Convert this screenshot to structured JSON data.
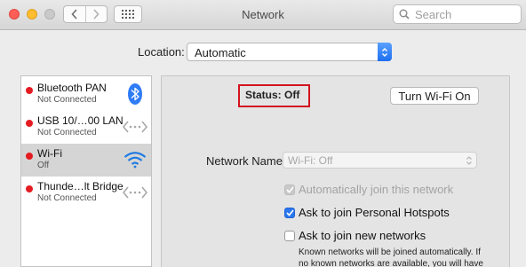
{
  "window": {
    "title": "Network"
  },
  "toolbar": {
    "back_icon": "chevron-left-icon",
    "forward_icon": "chevron-right-icon",
    "grid_icon": "grid-icon",
    "search_placeholder": "Search"
  },
  "location": {
    "label": "Location:",
    "value": "Automatic"
  },
  "sidebar": {
    "items": [
      {
        "name": "Bluetooth PAN",
        "status": "Not Connected",
        "icon": "bluetooth-icon",
        "status_color": "#e41c22"
      },
      {
        "name": "USB 10/…00 LAN",
        "status": "Not Connected",
        "icon": "ethernet-arrows-icon",
        "status_color": "#e41c22"
      },
      {
        "name": "Wi-Fi",
        "status": "Off",
        "icon": "wifi-icon",
        "status_color": "#e41c22",
        "selected": true
      },
      {
        "name": "Thunde…lt Bridge",
        "status": "Not Connected",
        "icon": "ethernet-arrows-icon",
        "status_color": "#e41c22"
      }
    ]
  },
  "main": {
    "status_label": "Status:",
    "status_value": "Off",
    "turn_wifi_button": "Turn Wi-Fi On",
    "network_name_label": "Network Name:",
    "network_name_value": "Wi-Fi: Off",
    "options": [
      {
        "label": "Automatically join this network",
        "checked": true,
        "disabled": true
      },
      {
        "label": "Ask to join Personal Hotspots",
        "checked": true,
        "disabled": false
      },
      {
        "label": "Ask to join new networks",
        "checked": false,
        "disabled": false
      }
    ],
    "note": "Known networks will be joined automatically. If no known networks are available, you will have"
  },
  "colors": {
    "accent": "#2b77f0",
    "status_red": "#e41c22",
    "highlight_box": "#d3141f"
  }
}
